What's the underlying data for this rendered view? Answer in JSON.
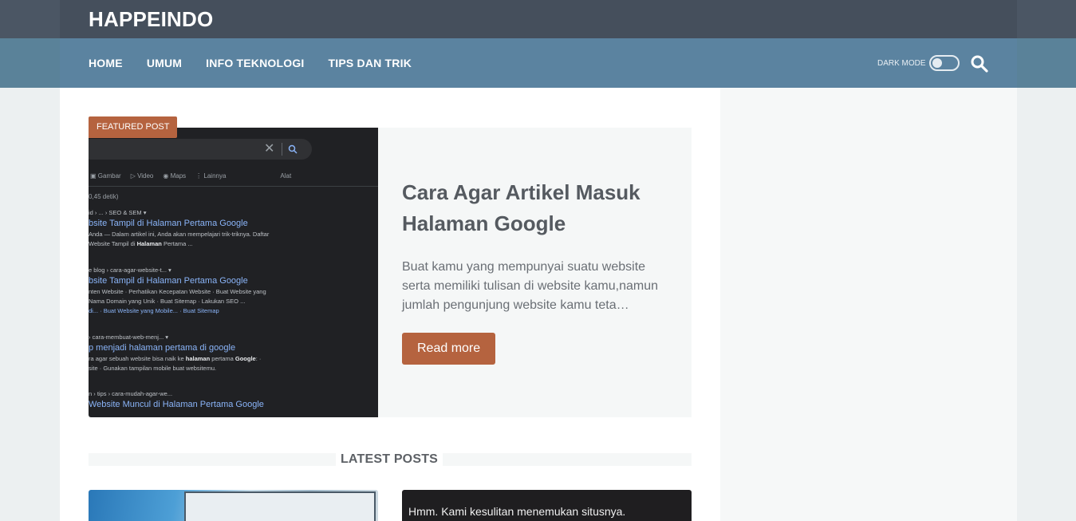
{
  "site": {
    "title": "HAPPEINDO"
  },
  "nav": {
    "items": [
      {
        "label": "HOME"
      },
      {
        "label": "UMUM"
      },
      {
        "label": "INFO TEKNOLOGI"
      },
      {
        "label": "TIPS DAN TRIK"
      }
    ],
    "dark_mode_label": "DARK MODE",
    "dark_mode_on": false,
    "search_icon": "search-icon"
  },
  "featured": {
    "badge": "FEATURED POST",
    "title": "Cara Agar Artikel Masuk Halaman Google",
    "excerpt": "Buat kamu yang mempunyai suatu website serta memiliki tulisan di website kamu,namun jumlah pengunjung website kamu teta…",
    "read_more": "Read more",
    "thumbnail": {
      "tabs": [
        "Gambar",
        "Video",
        "Maps",
        "Lainnya",
        "Alat"
      ],
      "result_count": "0,45 detik)",
      "results": [
        {
          "crumb": "id › ... › SEO & SEM ▾",
          "title": "bsite Tampil di Halaman Pertama Google",
          "snippet_1": "Anda — Dalam artikel ini, Anda akan mempelajari trik-triknya. Daftar",
          "snippet_2_pre": "Website Tampil di ",
          "snippet_2_bold": "Halaman",
          "snippet_2_post": " Pertama ..."
        },
        {
          "crumb": "e blog › cara-agar-website-t... ▾",
          "title": "bsite Tampil di Halaman Pertama Google",
          "snippet_1": "nten Website · Perhatikan Kecepatan Website · Buat Website yang",
          "snippet_2": "Nama Domain yang Unik · Buat Sitemap · Lakukan SEO ...",
          "links": "di... · Buat Website yang Mobile... · Buat Sitemap"
        },
        {
          "crumb": "› cara-membuat-web-menj... ▾",
          "title": "p menjadi halaman pertama di google",
          "snippet_1_pre": "ra agar sebuah website bisa naik ke ",
          "snippet_1_bold": "halaman",
          "snippet_1_mid": " pertama ",
          "snippet_1_bold2": "Google",
          "snippet_1_post": ": ·",
          "snippet_2": "site · Gunakan tampilan mobile buat websitemu."
        },
        {
          "crumb": "n › tips › cara-mudah-agar-we...",
          "title": "Website Muncul di Halaman Pertama Google"
        }
      ]
    }
  },
  "latest": {
    "heading": "LATEST POSTS",
    "posts": [
      {
        "thumbnail_text": ""
      },
      {
        "thumbnail_text": "Hmm. Kami kesulitan menemukan situsnya."
      }
    ]
  },
  "colors": {
    "accent": "#b5633f",
    "nav_bg": "#5b83a0",
    "header_bg": "#454f5c"
  }
}
